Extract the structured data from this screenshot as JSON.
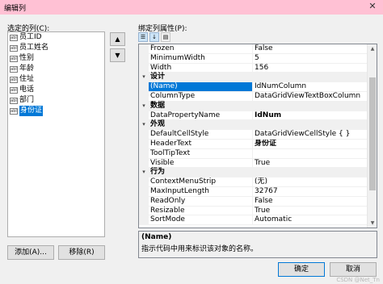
{
  "window": {
    "title": "编辑列",
    "close_glyph": "✕"
  },
  "columns_panel": {
    "label": "选定的列(C):",
    "item_icon_text": "abl",
    "items": [
      {
        "label": "员工ID",
        "selected": false
      },
      {
        "label": "员工姓名",
        "selected": false
      },
      {
        "label": "性别",
        "selected": false
      },
      {
        "label": "年龄",
        "selected": false
      },
      {
        "label": "住址",
        "selected": false
      },
      {
        "label": "电话",
        "selected": false
      },
      {
        "label": "部门",
        "selected": false
      },
      {
        "label": "身份证",
        "selected": true
      }
    ],
    "up_glyph": "▲",
    "down_glyph": "▼",
    "add_label": "添加(A)...",
    "remove_label": "移除(R)"
  },
  "properties_panel": {
    "label": "绑定列属性(P):",
    "toolbar": {
      "categorized_icon": "categorized-icon",
      "alphabetical_icon": "alphabetical-icon",
      "pages_icon": "property-pages-icon"
    },
    "rows": [
      {
        "type": "prop",
        "name": "Frozen",
        "value": "False"
      },
      {
        "type": "prop",
        "name": "MinimumWidth",
        "value": "5"
      },
      {
        "type": "prop",
        "name": "Width",
        "value": "156"
      },
      {
        "type": "cat",
        "name": "设计"
      },
      {
        "type": "prop",
        "name": "(Name)",
        "value": "IdNumColumn",
        "selected": true
      },
      {
        "type": "prop",
        "name": "ColumnType",
        "value": "DataGridViewTextBoxColumn"
      },
      {
        "type": "cat",
        "name": "数据"
      },
      {
        "type": "prop",
        "name": "DataPropertyName",
        "value": "IdNum",
        "bold": true
      },
      {
        "type": "cat",
        "name": "外观"
      },
      {
        "type": "prop",
        "name": "DefaultCellStyle",
        "value": "DataGridViewCellStyle { }"
      },
      {
        "type": "prop",
        "name": "HeaderText",
        "value": "身份证",
        "bold": true
      },
      {
        "type": "prop",
        "name": "ToolTipText",
        "value": ""
      },
      {
        "type": "prop",
        "name": "Visible",
        "value": "True"
      },
      {
        "type": "cat",
        "name": "行为"
      },
      {
        "type": "prop",
        "name": "ContextMenuStrip",
        "value": "(无)"
      },
      {
        "type": "prop",
        "name": "MaxInputLength",
        "value": "32767"
      },
      {
        "type": "prop",
        "name": "ReadOnly",
        "value": "False"
      },
      {
        "type": "prop",
        "name": "Resizable",
        "value": "True"
      },
      {
        "type": "prop",
        "name": "SortMode",
        "value": "Automatic"
      }
    ],
    "description": {
      "title": "(Name)",
      "text": "指示代码中用来标识该对象的名称。"
    }
  },
  "dialog_buttons": {
    "ok_label": "确定",
    "cancel_label": "取消"
  },
  "watermark": "CSDN @Net_Tn",
  "colors": {
    "titlebar": "#ffc1d4",
    "selection": "#0078d7"
  }
}
